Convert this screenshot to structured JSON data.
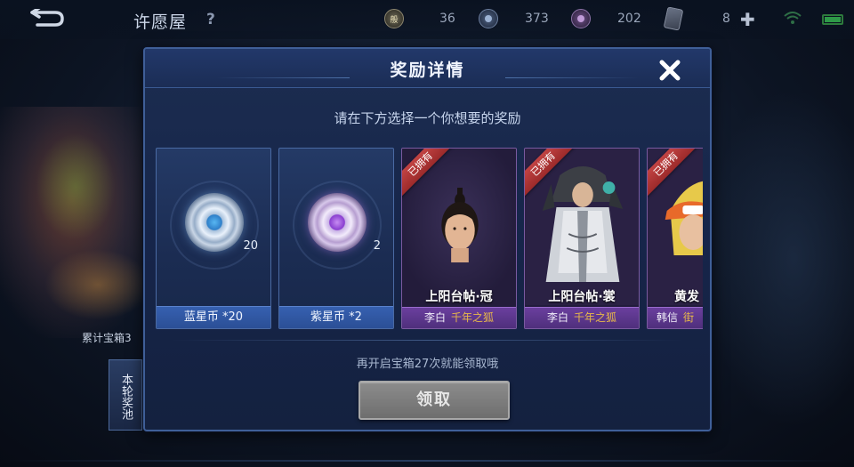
{
  "topbar": {
    "page_title": "许愿屋",
    "help_label": "?",
    "resources": [
      {
        "name": "gold-coin",
        "icon_text": "般",
        "value": "36"
      },
      {
        "name": "blue-star-coin",
        "value": "373"
      },
      {
        "name": "purple-star-coin",
        "value": "202"
      },
      {
        "name": "card",
        "value": "8"
      }
    ],
    "plus_label": "✚"
  },
  "background": {
    "accumulate_label": "累计宝箱3",
    "pool_label": "本轮奖池"
  },
  "modal": {
    "title": "奖励详情",
    "close_label": "✕",
    "subtitle": "请在下方选择一个你想要的奖励",
    "hint": "再开启宝箱27次就能领取哦",
    "claim_label": "领取"
  },
  "rewards": [
    {
      "kind": "coin",
      "label": "蓝星币 *20",
      "count": "20"
    },
    {
      "kind": "coin",
      "label": "紫星币 *2",
      "count": "2"
    },
    {
      "kind": "skin",
      "owned_label": "已拥有",
      "name": "上阳台帖·冠",
      "hero": "李白",
      "series": "千年之狐"
    },
    {
      "kind": "skin",
      "owned_label": "已拥有",
      "name": "上阳台帖·裳",
      "hero": "李白",
      "series": "千年之狐"
    },
    {
      "kind": "skin",
      "owned_label": "已拥有",
      "name": "黄发",
      "hero": "韩信",
      "series": "街"
    }
  ],
  "colors": {
    "modal_bg": "#1c2d50",
    "coin_label_bg": "#3660b0",
    "skin_bar_bg": "#6a3f9e",
    "owned_ribbon": "#c24343",
    "series_text": "#e8b84a",
    "claim_button": "#8c8c8c"
  }
}
